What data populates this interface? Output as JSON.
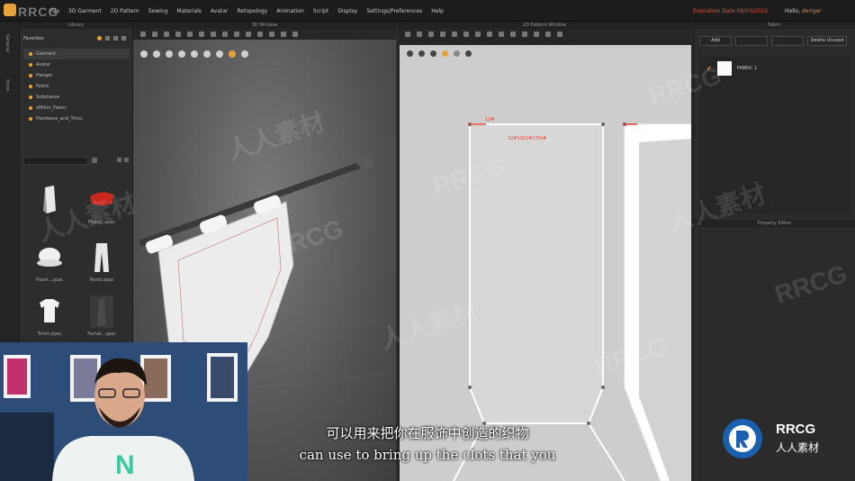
{
  "app": {
    "brand": "RRCG"
  },
  "menu": [
    "File",
    "3D Garment",
    "2D Pattern",
    "Sewing",
    "Materials",
    "Avatar",
    "Retopology",
    "Animation",
    "Script",
    "Display",
    "Settings/Preferences",
    "Help"
  ],
  "header": {
    "expiry": "Expiration Date 06/03/2022",
    "hello": "Hello,",
    "user": "deriger"
  },
  "vtabs": [
    "General",
    "Store"
  ],
  "library": {
    "title": "Library",
    "favorites_label": "Favorites",
    "favorites": [
      "Garment",
      "Avatar",
      "Hanger",
      "Fabric",
      "Substance",
      "xMiller_Fabric",
      "Hardware_and_Trims"
    ],
    "items": [
      "",
      "Heart...zpac",
      "Heart...zpac",
      "Pants.zpac",
      "Tshirt.zpac",
      "Femal...zpac"
    ]
  },
  "window3d": {
    "title": "3D Window"
  },
  "window2d": {
    "title": "2D Pattern Window",
    "dim_a": "12#",
    "dim_b": "12#1912#17th#"
  },
  "fabric": {
    "title": "Fabric",
    "add": "Add",
    "delete_unused": "Delete Unused",
    "item": "FABRIC 1"
  },
  "property_editor": {
    "title": "Property Editor"
  },
  "subtitles": {
    "cn": "可以用来把你在服饰中创造的织物",
    "en": "can use to bring up the clots that you"
  },
  "watermark": {
    "en": "RRCG",
    "cn": "人人素材"
  },
  "colors": {
    "accent": "#e8a23a",
    "expiry": "#e0503a",
    "pattern_bg": "#cdcdcd",
    "viewport": "#5e5e5e"
  }
}
